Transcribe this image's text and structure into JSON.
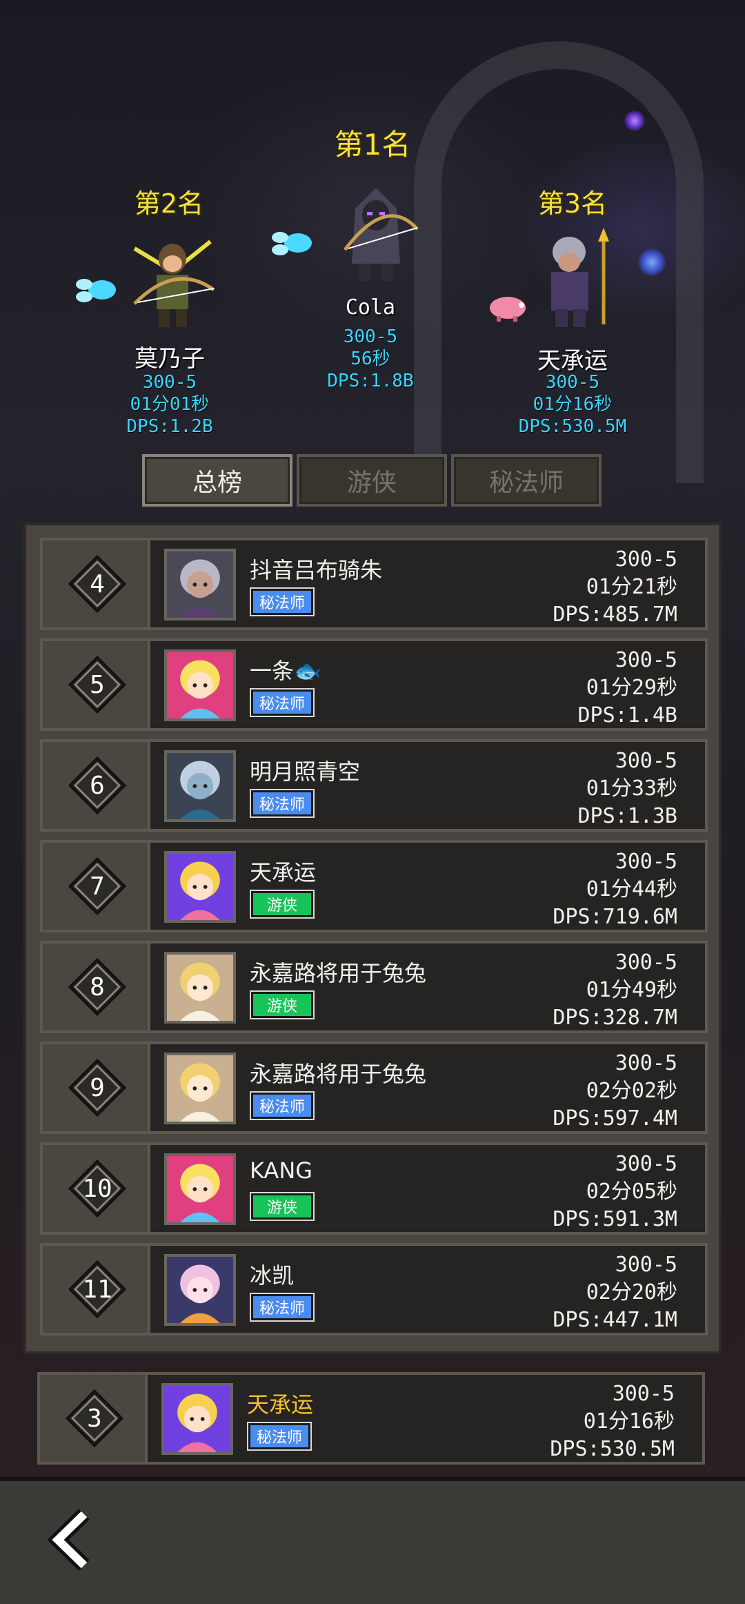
{
  "podium": {
    "first": {
      "title": "第1名",
      "name": "Cola",
      "score": "300-5",
      "time": "56秒",
      "dps": "DPS:1.8B"
    },
    "second": {
      "title": "第2名",
      "name": "莫乃子",
      "score": "300-5",
      "time": "01分01秒",
      "dps": "DPS:1.2B"
    },
    "third": {
      "title": "第3名",
      "name": "天承运",
      "score": "300-5",
      "time": "01分16秒",
      "dps": "DPS:530.5M"
    }
  },
  "tabs": [
    {
      "label": "总榜",
      "active": true
    },
    {
      "label": "游侠",
      "active": false
    },
    {
      "label": "秘法师",
      "active": false
    }
  ],
  "rows": [
    {
      "rank": "4",
      "name": "抖音吕布骑朱",
      "class": "秘法师",
      "score": "300-5",
      "time": "01分21秒",
      "dps": "DPS:485.7M"
    },
    {
      "rank": "5",
      "name": "一条🐟",
      "class": "秘法师",
      "score": "300-5",
      "time": "01分29秒",
      "dps": "DPS:1.4B"
    },
    {
      "rank": "6",
      "name": "明月照青空",
      "class": "秘法师",
      "score": "300-5",
      "time": "01分33秒",
      "dps": "DPS:1.3B"
    },
    {
      "rank": "7",
      "name": "天承运",
      "class": "游侠",
      "score": "300-5",
      "time": "01分44秒",
      "dps": "DPS:719.6M"
    },
    {
      "rank": "8",
      "name": "永嘉路将用于兔兔",
      "class": "游侠",
      "score": "300-5",
      "time": "01分49秒",
      "dps": "DPS:328.7M"
    },
    {
      "rank": "9",
      "name": "永嘉路将用于兔兔",
      "class": "秘法师",
      "score": "300-5",
      "time": "02分02秒",
      "dps": "DPS:597.4M"
    },
    {
      "rank": "10",
      "name": "KANG",
      "class": "游侠",
      "score": "300-5",
      "time": "02分05秒",
      "dps": "DPS:591.3M"
    },
    {
      "rank": "11",
      "name": "冰凯",
      "class": "秘法师",
      "score": "300-5",
      "time": "02分20秒",
      "dps": "DPS:447.1M"
    }
  ],
  "my_rank": {
    "rank": "3",
    "name": "天承运",
    "class": "秘法师",
    "score": "300-5",
    "time": "01分16秒",
    "dps": "DPS:530.5M"
  },
  "colors": {
    "mage_badge": "#4a8cf0",
    "ranger_badge": "#18c45a",
    "rank_title": "#f5e23a",
    "stat_cyan": "#3ad6ff",
    "my_name": "#f5c030"
  }
}
